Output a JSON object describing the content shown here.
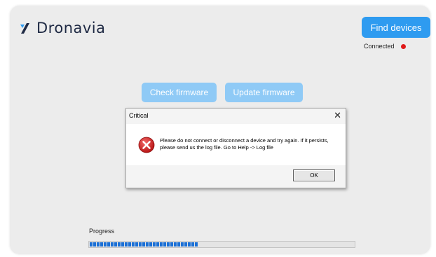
{
  "app": {
    "logo_text": "Dronavia",
    "logo_icon": "slash-logo-icon",
    "accent_color": "#2e9bf0"
  },
  "header": {
    "find_devices_label": "Find devices",
    "status_text": "Connected",
    "status_color": "#e01a1a"
  },
  "actions": {
    "check_firmware_label": "Check firmware",
    "update_firmware_label": "Update firmware"
  },
  "dialog": {
    "title": "Critical",
    "close_icon": "close-icon",
    "close_glyph": "✕",
    "error_icon": "error-icon",
    "message": "Please do not connect or disconnect a device and try again. If it persists, please send us the log file. Go to Help -> Log file",
    "ok_label": "OK"
  },
  "progress": {
    "label": "Progress",
    "value_fraction": 0.41
  }
}
